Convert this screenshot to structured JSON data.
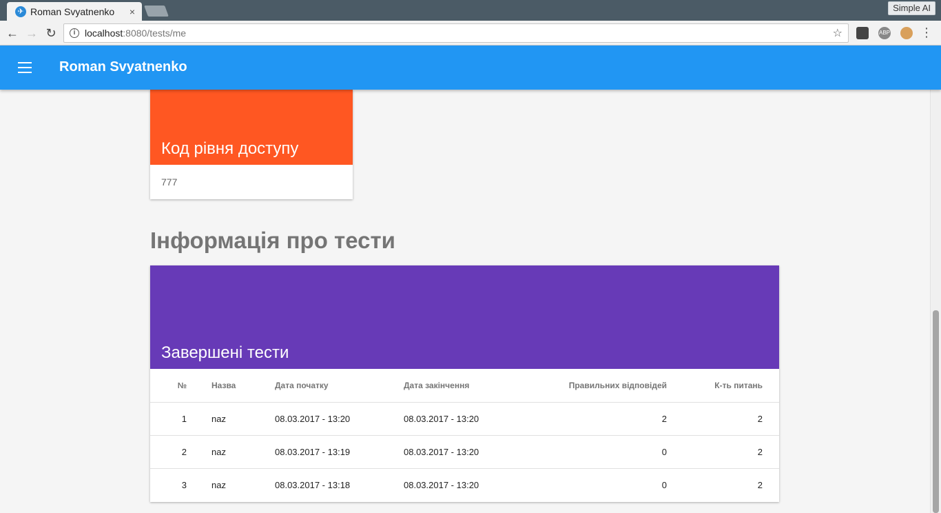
{
  "browser": {
    "tab_title": "Roman Svyatnenko",
    "tab_close": "×",
    "url_host": "localhost",
    "url_path": ":8080/tests/me",
    "extension_badge": "Simple AI",
    "ext_abp": "ABP"
  },
  "appbar": {
    "title": "Roman Svyatnenko",
    "color": "#2196f3"
  },
  "access_card": {
    "title": "Код рівня доступу",
    "value": "777",
    "color": "#ff5722"
  },
  "section": {
    "title": "Інформація про тести"
  },
  "tests_card": {
    "title": "Завершені тести",
    "color": "#673ab7",
    "columns": [
      "№",
      "Назва",
      "Дата початку",
      "Дата закінчення",
      "Правильних відповідей",
      "К-ть питань"
    ],
    "rows": [
      [
        "1",
        "naz",
        "08.03.2017 - 13:20",
        "08.03.2017 - 13:20",
        "2",
        "2"
      ],
      [
        "2",
        "naz",
        "08.03.2017 - 13:19",
        "08.03.2017 - 13:20",
        "0",
        "2"
      ],
      [
        "3",
        "naz",
        "08.03.2017 - 13:18",
        "08.03.2017 - 13:20",
        "0",
        "2"
      ]
    ]
  }
}
